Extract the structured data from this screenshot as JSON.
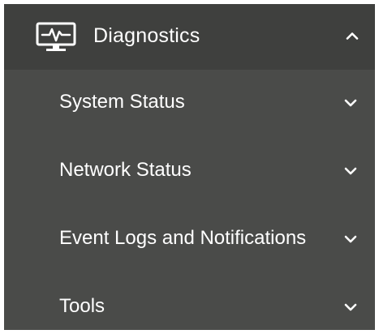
{
  "colors": {
    "panel_background": "#4a4b49",
    "header_background": "#3f403e",
    "text": "#ffffff"
  },
  "menu": {
    "header": {
      "title": "Diagnostics",
      "icon": "monitor-pulse-icon",
      "state_icon": "chevron-up-icon",
      "expanded": true
    },
    "items": [
      {
        "label": "System Status",
        "icon": "chevron-down-icon"
      },
      {
        "label": "Network Status",
        "icon": "chevron-down-icon"
      },
      {
        "label": "Event Logs and Notifications",
        "icon": "chevron-down-icon"
      },
      {
        "label": "Tools",
        "icon": "chevron-down-icon"
      }
    ]
  }
}
